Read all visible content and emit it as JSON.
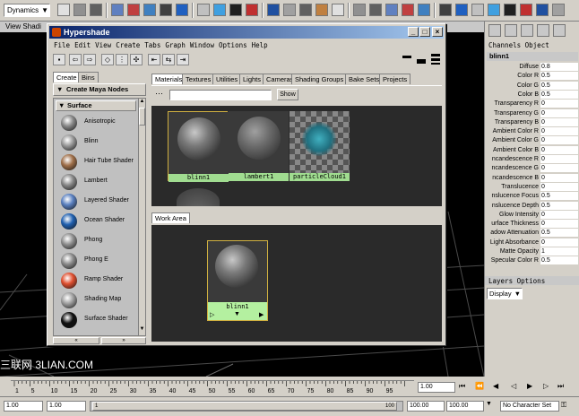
{
  "toolbar": {
    "mode": "Dynamics"
  },
  "viewport": {
    "menu": "View  Shadi"
  },
  "watermark": "三联网 3LIAN.COM",
  "hypershade": {
    "title": "Hypershade",
    "menu": [
      "File",
      "Edit",
      "View",
      "Create",
      "Tabs",
      "Graph",
      "Window",
      "Options",
      "Help"
    ],
    "create_tabs": [
      "Create",
      "Bins"
    ],
    "create_header": "Create Maya Nodes",
    "surface_header": "Surface",
    "shaders": [
      {
        "label": "Anisotropic",
        "color": "#8a8a8a"
      },
      {
        "label": "Blinn",
        "color": "#9a9a9a"
      },
      {
        "label": "Hair Tube Shader",
        "color": "#a0704a"
      },
      {
        "label": "Lambert",
        "color": "#888888"
      },
      {
        "label": "Layered Shader",
        "color": "#5a80c0"
      },
      {
        "label": "Ocean Shader",
        "color": "#2060b0"
      },
      {
        "label": "Phong",
        "color": "#909090"
      },
      {
        "label": "Phong E",
        "color": "#8c8c8c"
      },
      {
        "label": "Ramp Shader",
        "color": "#e05030"
      },
      {
        "label": "Shading Map",
        "color": "#a0a0a0"
      },
      {
        "label": "Surface Shader",
        "color": "#101010"
      }
    ],
    "tabs": [
      "Materials",
      "Textures",
      "Utilities",
      "Lights",
      "Cameras",
      "Shading Groups",
      "Bake Sets",
      "Projects"
    ],
    "show_button": "Show",
    "swatches": [
      "blinn1",
      "lambert1",
      "particleCloud1"
    ],
    "work_area_tab": "Work Area",
    "work_node": "blinn1"
  },
  "channels": {
    "menu": "Channels  Object",
    "node": "blinn1",
    "attrs": [
      {
        "name": "Diffuse",
        "value": "0.8"
      },
      {
        "name": "Color R",
        "value": "0.5"
      },
      {
        "name": "Color G",
        "value": "0.5"
      },
      {
        "name": "Color B",
        "value": "0.5"
      },
      {
        "name": "Transparency R",
        "value": "0"
      },
      {
        "name": "Transparency G",
        "value": "0"
      },
      {
        "name": "Transparency B",
        "value": "0"
      },
      {
        "name": "Ambient Color R",
        "value": "0"
      },
      {
        "name": "Ambient Color G",
        "value": "0"
      },
      {
        "name": "Ambient Color B",
        "value": "0"
      },
      {
        "name": "ncandescence R",
        "value": "0"
      },
      {
        "name": "ncandescence G",
        "value": "0"
      },
      {
        "name": "ncandescence B",
        "value": "0"
      },
      {
        "name": "Translucence",
        "value": "0"
      },
      {
        "name": "nslucence Focus",
        "value": "0.5"
      },
      {
        "name": "nslucence Depth",
        "value": "0.5"
      },
      {
        "name": "Glow Intensity",
        "value": "0"
      },
      {
        "name": "urface Thickness",
        "value": "0"
      },
      {
        "name": "adow Attenuation",
        "value": "0.5"
      },
      {
        "name": "Light Absorbance",
        "value": "0"
      },
      {
        "name": "Matte Opacity",
        "value": "1"
      },
      {
        "name": "Specular Color R",
        "value": "0.5"
      }
    ],
    "layers_menu": "Layers  Options",
    "layers_dropdown": "Display"
  },
  "timeline": {
    "ticks": [
      "1",
      "5",
      "10",
      "15",
      "20",
      "25",
      "30",
      "35",
      "40",
      "45",
      "50",
      "55",
      "60",
      "65",
      "70",
      "75",
      "80",
      "85",
      "90",
      "95"
    ],
    "current": "1.00"
  },
  "range": {
    "start": "1.00",
    "inner_start": "1.00",
    "mid": "100.00",
    "inner_end": "100.00",
    "end": "100.00",
    "slider_left": "1",
    "slider_right": "100",
    "character": "No Character Set"
  }
}
